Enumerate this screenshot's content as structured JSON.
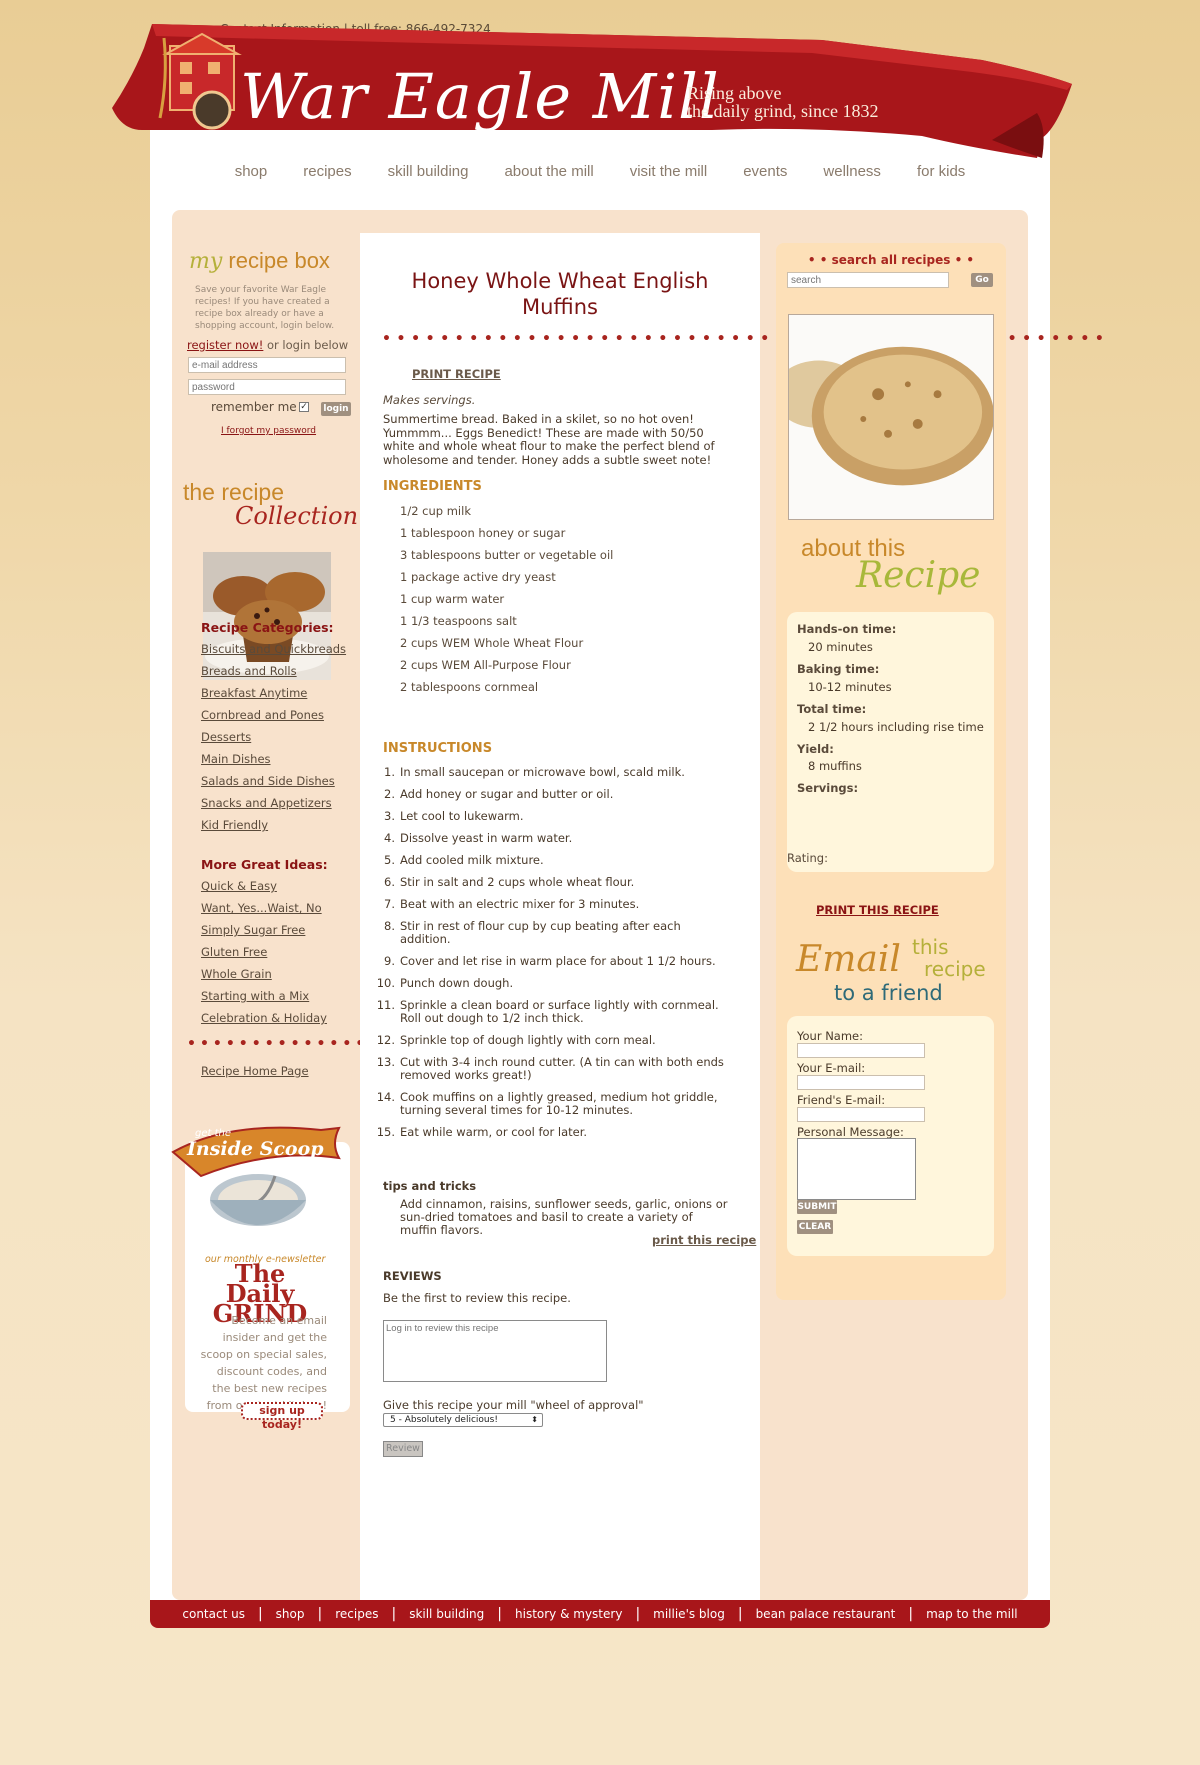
{
  "top": {
    "contact_link": "Contact Information",
    "toll_free": "| toll free: 866-492-7324"
  },
  "brand": {
    "name": "War Eagle Mill",
    "tagline_line1": "Rising above",
    "tagline_line2": "the daily grind, since 1832"
  },
  "nav": [
    "shop",
    "recipes",
    "skill building",
    "about the mill",
    "visit the mill",
    "events",
    "wellness",
    "for kids"
  ],
  "recipe_box": {
    "title_my": "my",
    "title_rest": "recipe box",
    "description": "Save your favorite War Eagle recipes! If you have created a recipe box already or have a shopping account, login below.",
    "register_link": "register now!",
    "register_suffix": " or login below",
    "email_placeholder": "e-mail address",
    "password_placeholder": "password",
    "remember_label": "remember me",
    "login_button": "login",
    "forgot_link": "I forgot my password"
  },
  "collection": {
    "title": "the recipe",
    "script": "Collection"
  },
  "categories": {
    "heading": "Recipe Categories:",
    "items": [
      "Biscuits and Quickbreads",
      "Breads and Rolls",
      "Breakfast Anytime",
      "Cornbread and Pones",
      "Desserts",
      "Main Dishes",
      "Salads and Side Dishes",
      "Snacks and Appetizers",
      "Kid Friendly"
    ]
  },
  "ideas": {
    "heading": "More Great Ideas:",
    "items": [
      "Quick & Easy",
      "Want, Yes...Waist, No",
      "Simply Sugar Free",
      "Gluten Free",
      "Whole Grain",
      "Starting with a Mix",
      "Celebration & Holiday"
    ]
  },
  "recipe_home_link": "Recipe Home Page",
  "newsletter": {
    "ribbon_small": "get the",
    "ribbon_big": "Inside Scoop",
    "subtitle": "our monthly e-newsletter",
    "name_line1": "The Daily",
    "name_line2": "GRIND",
    "text": "Become an email insider and get the scoop on special sales, discount codes, and the best new recipes from our test kitchen!",
    "button": "sign up today!"
  },
  "recipe": {
    "title": "Honey Whole Wheat English Muffins",
    "print_top": "PRINT RECIPE",
    "makes": "Makes servings.",
    "intro": "Summertime bread. Baked in a skilet, so no hot oven! Yummmm... Eggs Benedict! These are made with 50/50 white and whole wheat flour to make the perfect blend of wholesome and tender. Honey adds a subtle sweet note!",
    "ingredients_heading": "INGREDIENTS",
    "ingredients": [
      "1/2 cup milk",
      "1 tablespoon honey or sugar",
      "3 tablespoons butter or vegetable oil",
      "1 package active dry yeast",
      "1 cup warm water",
      "1 1/3 teaspoons salt",
      "2 cups WEM Whole Wheat Flour",
      "2 cups WEM All-Purpose Flour",
      "2 tablespoons cornmeal"
    ],
    "instructions_heading": "INSTRUCTIONS",
    "instructions": [
      "In small saucepan or microwave bowl, scald milk.",
      "Add honey or sugar and butter or oil.",
      "Let cool to lukewarm.",
      "Dissolve yeast in warm water.",
      "Add cooled milk mixture.",
      "Stir in salt and 2 cups whole wheat flour.",
      "Beat with an electric mixer for 3 minutes.",
      "Stir in rest of flour cup by cup beating after each addition.",
      "Cover and let rise in warm place for about 1 1/2 hours.",
      "Punch down dough.",
      "Sprinkle a clean board or surface lightly with cornmeal. Roll out dough to 1/2 inch thick.",
      "Sprinkle top of dough lightly with corn meal.",
      "Cut with 3-4 inch round cutter. (A tin can with both ends removed works great!)",
      "Cook muffins on a lightly greased, medium hot griddle, turning several times for 10-12 minutes.",
      "Eat while warm, or cool for later."
    ],
    "tips_heading": "tips and tricks",
    "tips_text": "Add cinnamon, raisins, sunflower seeds, garlic, onions or sun-dried tomatoes and basil to create a variety of muffin flavors.",
    "print_bottom": "print this recipe"
  },
  "reviews": {
    "heading": "REVIEWS",
    "first": "Be the first to review this recipe.",
    "textarea_placeholder": "Log in to review this recipe",
    "give_label": "Give this recipe your mill \"wheel of approval\"",
    "select_value": "5 - Absolutely delicious!",
    "button": "Review"
  },
  "search": {
    "heading": "• •  search all recipes  • •",
    "placeholder": "search",
    "button": "Go"
  },
  "about": {
    "title": "about this",
    "script": "Recipe",
    "hands_on_label": "Hands-on time:",
    "hands_on_value": "20 minutes",
    "baking_label": "Baking time:",
    "baking_value": "10-12 minutes",
    "total_label": "Total time:",
    "total_value": "2 1/2 hours including rise time",
    "yield_label": "Yield:",
    "yield_value": "8 muffins",
    "servings_label": "Servings:",
    "rating_label": "Rating:"
  },
  "print_right": "PRINT THIS RECIPE",
  "email_friend": {
    "script": "Email",
    "this": "this",
    "recipe": "recipe",
    "to_friend": "to a friend",
    "name_label": "Your Name:",
    "email_label": "Your E-mail:",
    "friend_label": "Friend's E-mail:",
    "message_label": "Personal Message:",
    "submit": "SUBMIT",
    "clear": "CLEAR"
  },
  "footer": [
    "contact us",
    "shop",
    "recipes",
    "skill building",
    "history & mystery",
    "millie's blog",
    "bean palace restaurant",
    "map to the mill"
  ],
  "colors": {
    "brand_red": "#a8161a",
    "accent_gold": "#c8882a",
    "panel_peach": "#f8e2cc"
  }
}
